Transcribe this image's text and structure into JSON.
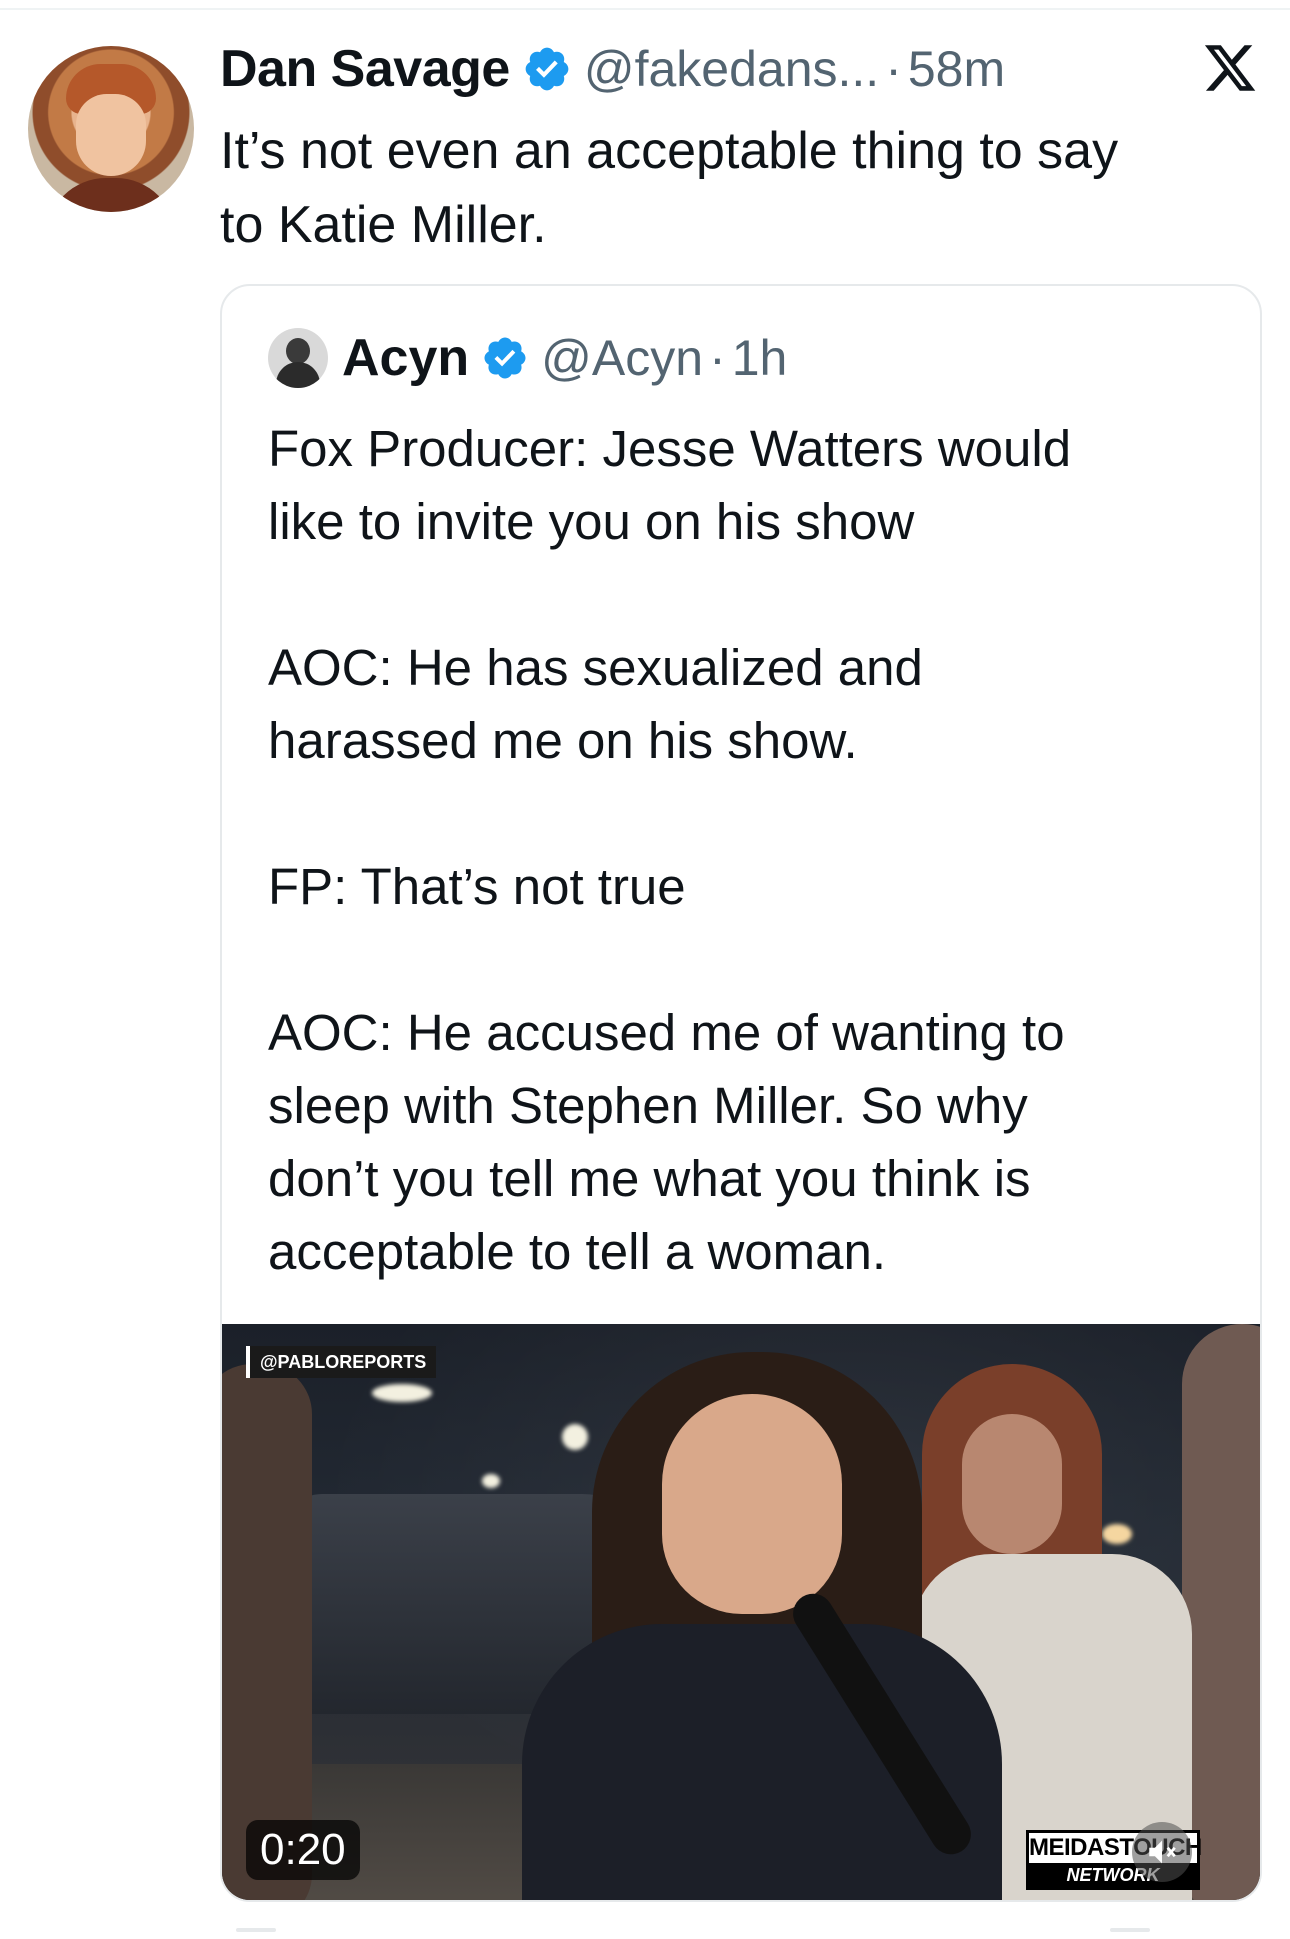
{
  "tweet": {
    "display_name": "Dan Savage",
    "handle": "@fakedans...",
    "separator": "·",
    "time": "58m",
    "text": "It’s not even an acceptable thing to say\nto Katie Miller.",
    "verified_color": "#1d9bf0"
  },
  "quoted": {
    "display_name": "Acyn",
    "handle": "@Acyn",
    "separator": "·",
    "time": "1h",
    "paragraphs": [
      "Fox Producer: Jesse Watters would\nlike to invite you on his show",
      "AOC: He has sexualized and\nharassed me on his show.",
      "FP: That’s not true",
      "AOC: He accused me of wanting to\nsleep with Stephen Miller. So why\ndon’t you tell me what you think is\nacceptable to tell a woman."
    ],
    "video": {
      "source_tag": "@PABLOREPORTS",
      "duration": "0:20",
      "brand_top": "MEIDASTOUCH",
      "brand_bottom": "NETWORK",
      "icons": [
        "volume-muted-icon"
      ]
    }
  },
  "icons": [
    "verified-badge-icon",
    "x-logo-icon"
  ]
}
